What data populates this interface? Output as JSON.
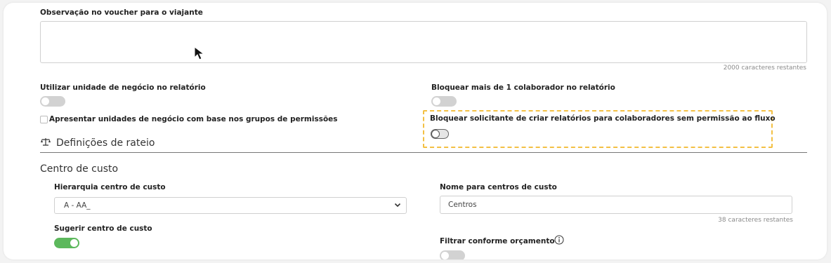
{
  "voucher": {
    "label": "Observação no voucher para o viajante",
    "value": "",
    "counter": "2000 caracteres restantes"
  },
  "business_unit": {
    "label": "Utilizar unidade de negócio no relatório",
    "enabled": false,
    "checkbox_label": "Apresentar unidades de negócio com base nos grupos de permissões",
    "checked": false
  },
  "block_multiple": {
    "label": "Bloquear mais de 1 colaborador no relatório",
    "enabled": false
  },
  "block_requester": {
    "label": "Bloquear solicitante de criar relatórios para colaboradores sem permissão ao fluxo",
    "enabled": false,
    "highlight_color": "#f3c044"
  },
  "rateio": {
    "icon": "scale-balance-icon",
    "title": "Definições de rateio"
  },
  "cost_center": {
    "title": "Centro de custo",
    "hierarchy_label": "Hierarquia centro de custo",
    "hierarchy_value": "A - AA_",
    "name_label": "Nome para centros de custo",
    "name_value": "Centros",
    "name_counter": "38 caracteres restantes",
    "suggest_label": "Sugerir centro de custo",
    "suggest_enabled": true,
    "filter_label": "Filtrar conforme orçamento",
    "filter_enabled": false
  },
  "colors": {
    "toggle_on": "#5cb85c",
    "toggle_off": "#d2d2d2"
  }
}
